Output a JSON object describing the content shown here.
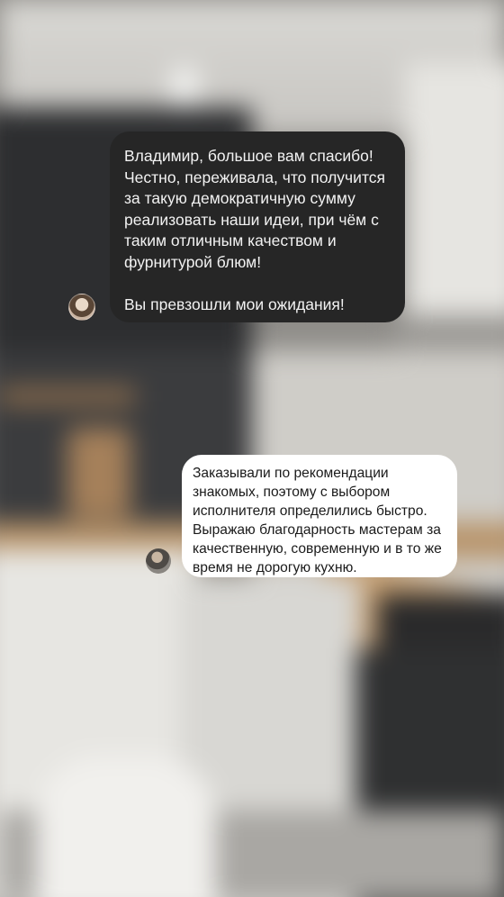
{
  "comments": [
    {
      "theme": "dark",
      "text": "Владимир, большое вам спасибо!\nЧестно, переживала, что получится за такую демократичную сумму реализовать наши идеи, при чём с таким отличным качеством и фурнитурой блюм!\n\nВы превзошли мои ожидания!"
    },
    {
      "theme": "light",
      "text": "Заказывали по рекомендации знакомых, поэтому с выбором исполнителя определились быстро. Выражаю благодарность мастерам за качественную, современную и в то же время не дорогую кухню."
    }
  ],
  "colors": {
    "dark_bubble": "#262626",
    "light_bubble": "#ffffff"
  }
}
